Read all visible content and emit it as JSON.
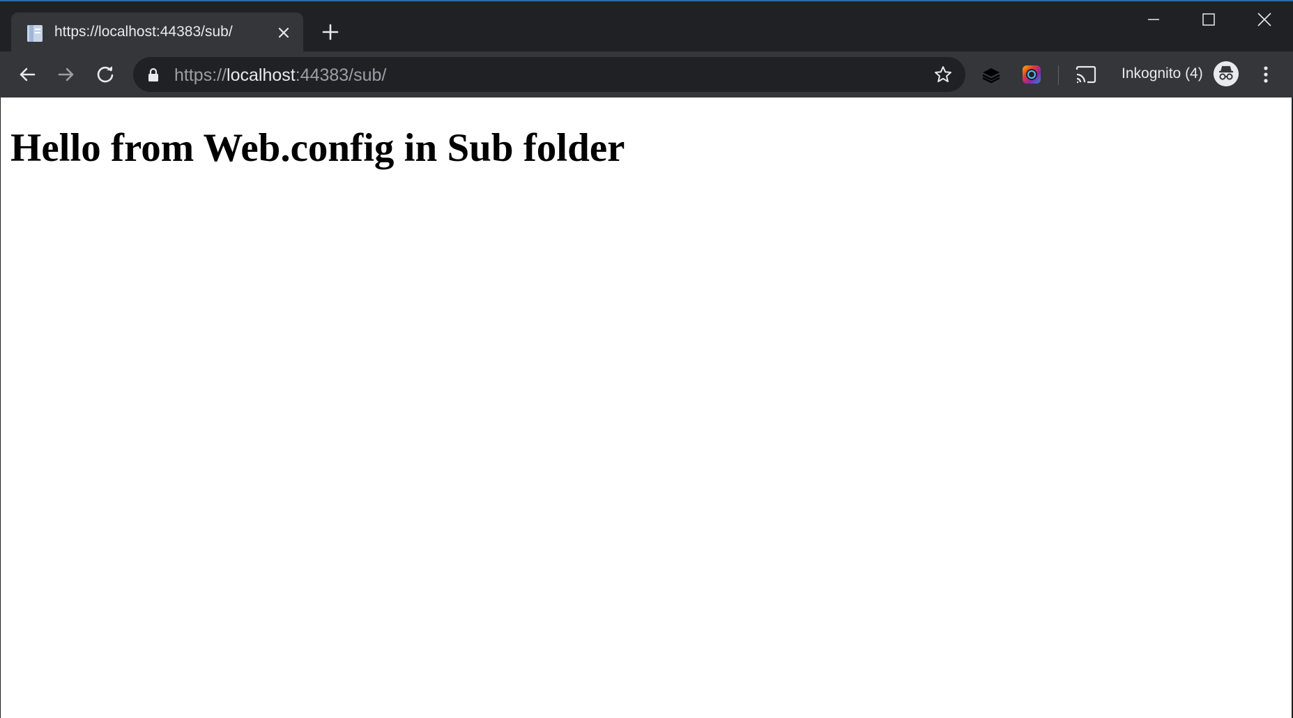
{
  "browser": {
    "tab": {
      "title": "https://localhost:44383/sub/"
    },
    "address_bar": {
      "url_scheme": "https://",
      "url_host": "localhost",
      "url_rest": ":44383/sub/"
    },
    "incognito_label": "Inkognito (4)"
  },
  "page": {
    "heading": "Hello from Web.config in Sub folder"
  },
  "colors": {
    "frame": "#202124",
    "toolbar": "#35363a",
    "text": "#e8eaed",
    "page_bg": "#ffffff"
  }
}
